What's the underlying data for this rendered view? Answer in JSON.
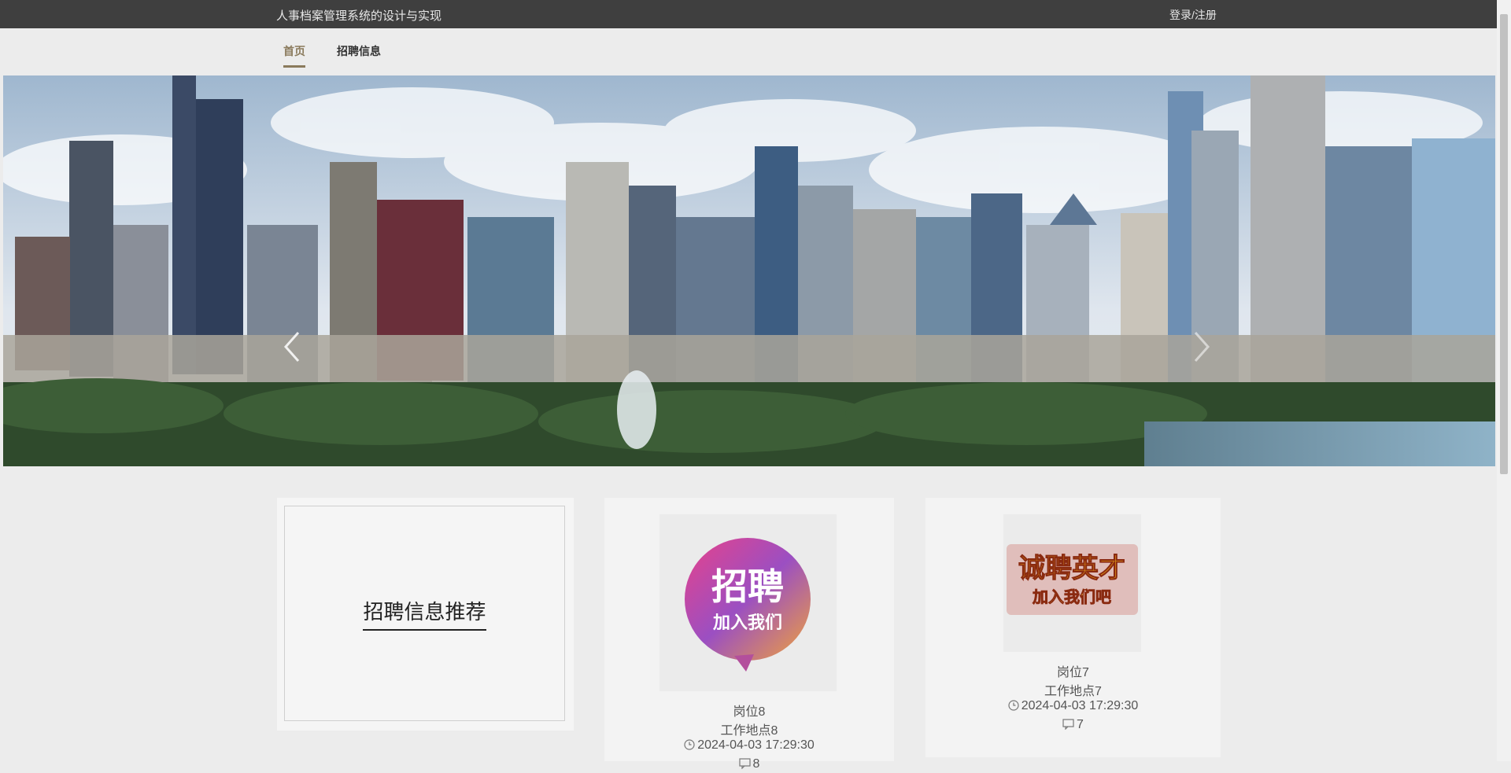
{
  "header": {
    "title": "人事档案管理系统的设计与实现",
    "login": "登录/注册"
  },
  "nav": {
    "items": [
      {
        "label": "首页",
        "active": true
      },
      {
        "label": "招聘信息",
        "active": false
      }
    ]
  },
  "carousel": {
    "slide_count": 3,
    "active_index": 2
  },
  "recommend": {
    "title": "招聘信息推荐"
  },
  "cards": [
    {
      "job": "岗位8",
      "location": "工作地点8",
      "time": "2024-04-03 17:29:30",
      "count": "8",
      "thumb_text_top": "招聘",
      "thumb_text_bottom": "加入我们"
    },
    {
      "job": "岗位7",
      "location": "工作地点7",
      "time": "2024-04-03 17:29:30",
      "count": "7",
      "thumb_text_top": "诚聘英才",
      "thumb_text_bottom": "加入我们吧"
    }
  ],
  "colors": {
    "topbar": "#3f3f3f",
    "accent": "#8a7a5c",
    "active_dot": "#c9a227"
  }
}
